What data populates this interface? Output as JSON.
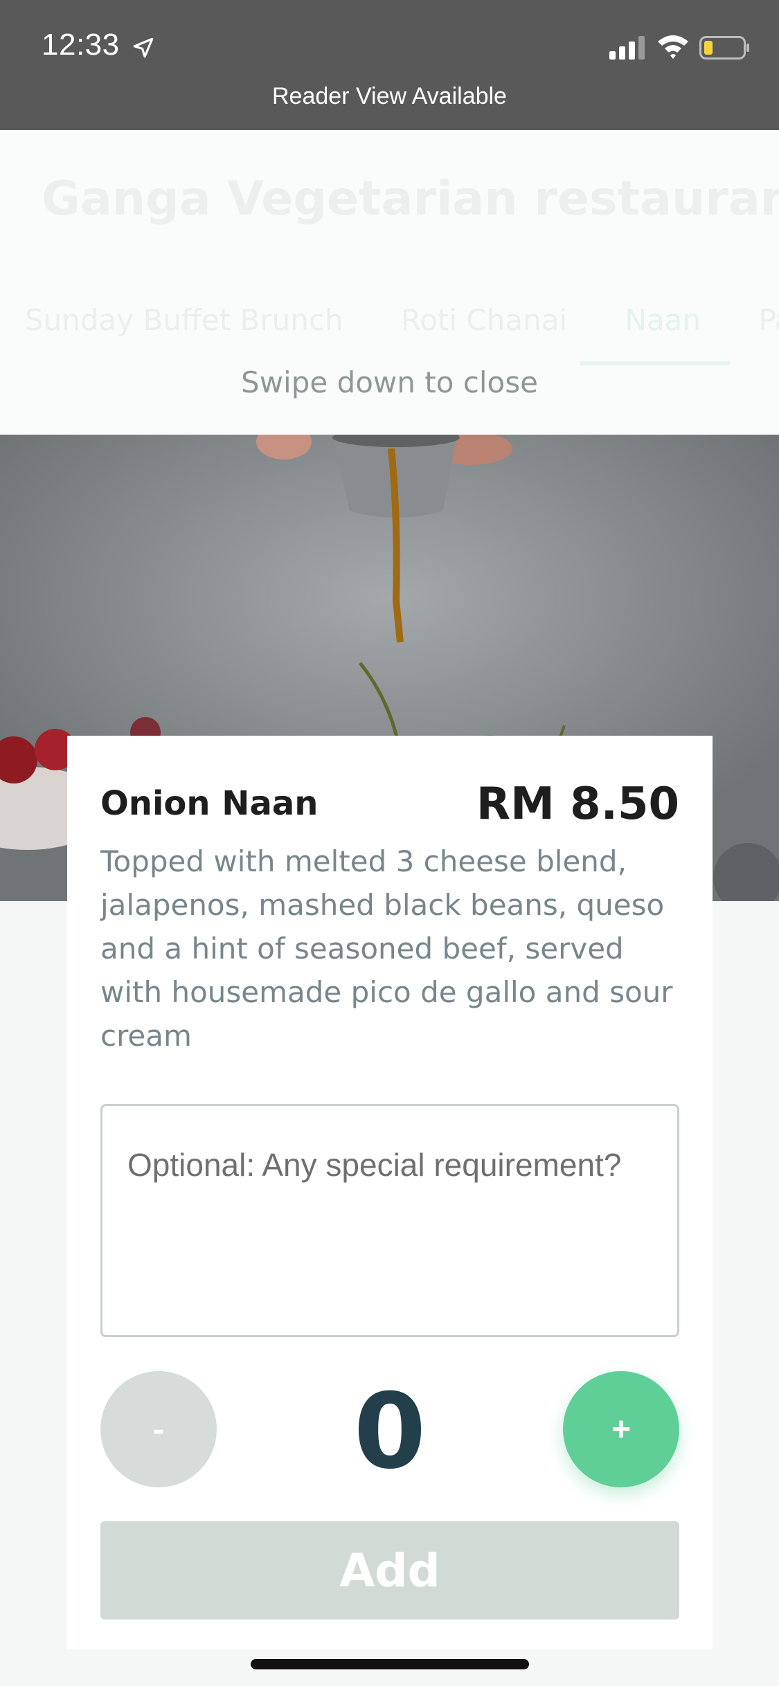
{
  "status_bar": {
    "time": "12:33",
    "reader_view": "Reader View Available"
  },
  "background_page": {
    "restaurant_name": "Ganga Vegetarian restaurant",
    "tabs": [
      "Sunday Buffet Brunch",
      "Roti Chanai",
      "Naan",
      "Pa"
    ],
    "active_tab": "Naan"
  },
  "sheet": {
    "swipe_hint": "Swipe down to close"
  },
  "item": {
    "name": "Onion Naan",
    "price": "RM 8.50",
    "description": "Topped with melted 3 cheese blend, jalapenos, mashed black beans, queso and a hint of seasoned beef, served with housemade pico de gallo and sour cream",
    "notes_placeholder": "Optional: Any special requirement?",
    "quantity": "0",
    "minus_label": "-",
    "plus_label": "+",
    "add_label": "Add"
  },
  "colors": {
    "accent": "#5fcf97",
    "disabled": "#d2dad6",
    "quantity_text": "#223f4b",
    "status_bar": "#595959"
  }
}
